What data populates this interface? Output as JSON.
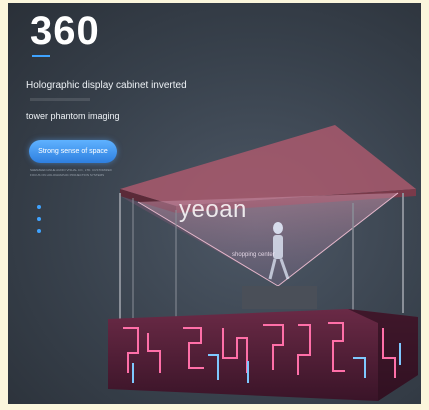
{
  "hero": {
    "number": "360",
    "title_line1": "Holographic display cabinet inverted",
    "title_line2": "tower phantom imaging",
    "badge": "Strong sense of space",
    "fine_print": "SHENZHEN ANHE AUDIO VISUAL CO., LTD. CUSTOMIZED FOCUS ON HOLOGRAPHIC PROJECTION SYSTEMS",
    "accent_color": "#3fa3ff"
  },
  "product": {
    "brand_watermark": "yeoan",
    "scene_sign": "shopping center"
  }
}
